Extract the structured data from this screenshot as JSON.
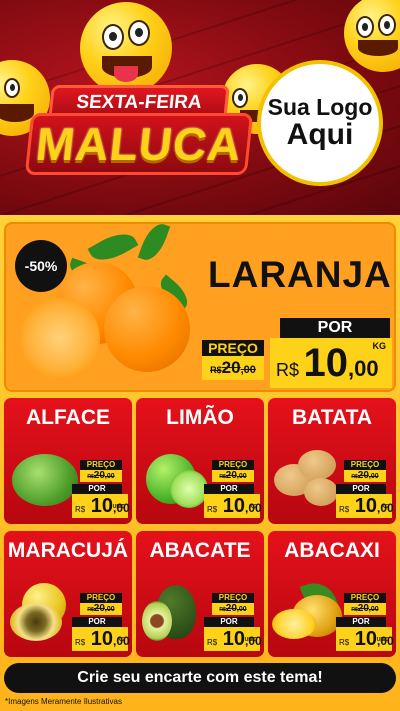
{
  "header": {
    "title_top": "SEXTA-FEIRA",
    "title_main": "MALUCA",
    "logo_line1": "Sua Logo",
    "logo_line2": "Aqui"
  },
  "hero": {
    "badge": "-50%",
    "name": "LARANJA",
    "preco_label": "PREÇO",
    "old_currency": "R$",
    "old_price": "20",
    "old_cents": ",00",
    "por_label": "POR",
    "new_currency": "R$",
    "new_int": "10",
    "new_cents": ",00",
    "unit": "KG"
  },
  "products": [
    {
      "name": "ALFACE",
      "preco_label": "PREÇO",
      "old_currency": "R$",
      "old_price": "20",
      "old_cents": ",00",
      "por_label": "POR",
      "new_currency": "R$",
      "new_int": "10",
      "new_cents": ",00",
      "unit": "UNID"
    },
    {
      "name": "LIMÃO",
      "preco_label": "PREÇO",
      "old_currency": "R$",
      "old_price": "20",
      "old_cents": ",00",
      "por_label": "POR",
      "new_currency": "R$",
      "new_int": "10",
      "new_cents": ",00",
      "unit": "KG"
    },
    {
      "name": "BATATA",
      "preco_label": "PREÇO",
      "old_currency": "R$",
      "old_price": "20",
      "old_cents": ",00",
      "por_label": "POR",
      "new_currency": "R$",
      "new_int": "10",
      "new_cents": ",00",
      "unit": "KG"
    },
    {
      "name": "MARACUJÁ",
      "preco_label": "PREÇO",
      "old_currency": "R$",
      "old_price": "20",
      "old_cents": ",00",
      "por_label": "POR",
      "new_currency": "R$",
      "new_int": "10",
      "new_cents": ",00",
      "unit": "KG"
    },
    {
      "name": "ABACATE",
      "preco_label": "PREÇO",
      "old_currency": "R$",
      "old_price": "20",
      "old_cents": ",00",
      "por_label": "POR",
      "new_currency": "R$",
      "new_int": "10",
      "new_cents": ",00",
      "unit": "UNID"
    },
    {
      "name": "ABACAXI",
      "preco_label": "PREÇO",
      "old_currency": "R$",
      "old_price": "20",
      "old_cents": ",00",
      "por_label": "POR",
      "new_currency": "R$",
      "new_int": "10",
      "new_cents": ",00",
      "unit": "UNID"
    }
  ],
  "cta": "Crie seu encarte com este tema!",
  "footnote": "*Imagens Meramente Ilustrativas",
  "colors": {
    "header_bg": "#7d0a10",
    "accent_yellow": "#ffd21a",
    "card_red": "#e5111b",
    "hero_orange": "#ffa020",
    "tag_black": "#111111"
  }
}
